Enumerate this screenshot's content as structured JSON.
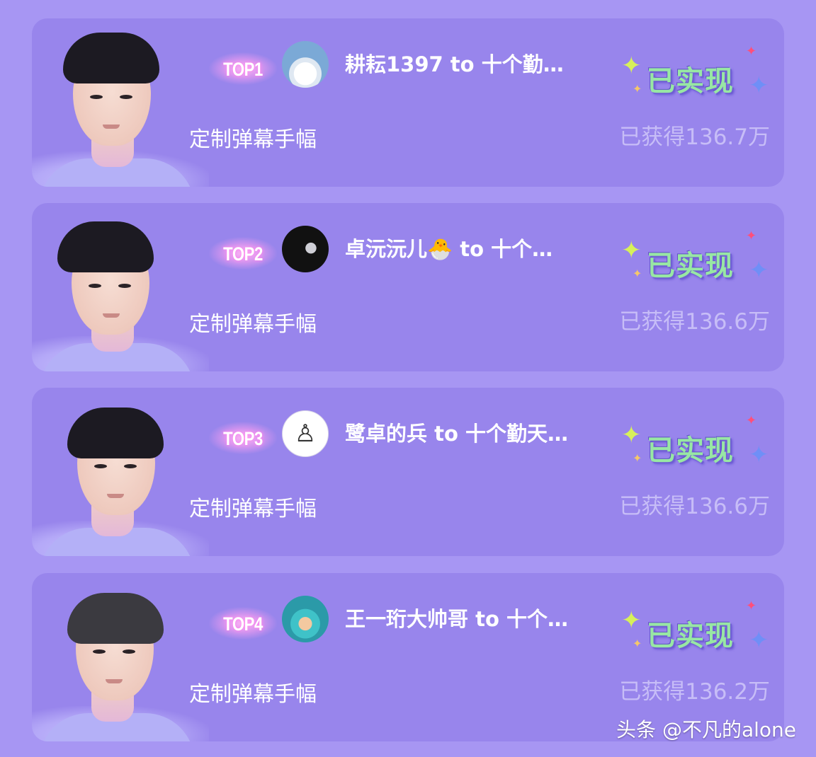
{
  "cards": [
    {
      "rank": "TOP1",
      "title": "耕耘1397 to 十个勤…",
      "subtitle": "定制弹幕手幅",
      "status": "已实现",
      "earned": "已获得136.7万",
      "avatar_icon": "user-avatar-icon"
    },
    {
      "rank": "TOP2",
      "title": "卓沅沅儿🐣 to 十个…",
      "subtitle": "定制弹幕手幅",
      "status": "已实现",
      "earned": "已获得136.6万",
      "avatar_icon": "user-avatar-icon"
    },
    {
      "rank": "TOP3",
      "title": "鹭卓的兵 to 十个勤天…",
      "subtitle": "定制弹幕手幅",
      "status": "已实现",
      "earned": "已获得136.6万",
      "avatar_icon": "user-avatar-icon"
    },
    {
      "rank": "TOP4",
      "title": "王一珩大帅哥 to 十个…",
      "subtitle": "定制弹幕手幅",
      "status": "已实现",
      "earned": "已获得136.2万",
      "avatar_icon": "user-avatar-icon"
    }
  ],
  "watermark": "头条 @不凡的alone",
  "colors": {
    "background": "#a796f3",
    "card": "#9885ec",
    "status_green": "#98e7a4",
    "earned_text": "#c7bdf7"
  }
}
